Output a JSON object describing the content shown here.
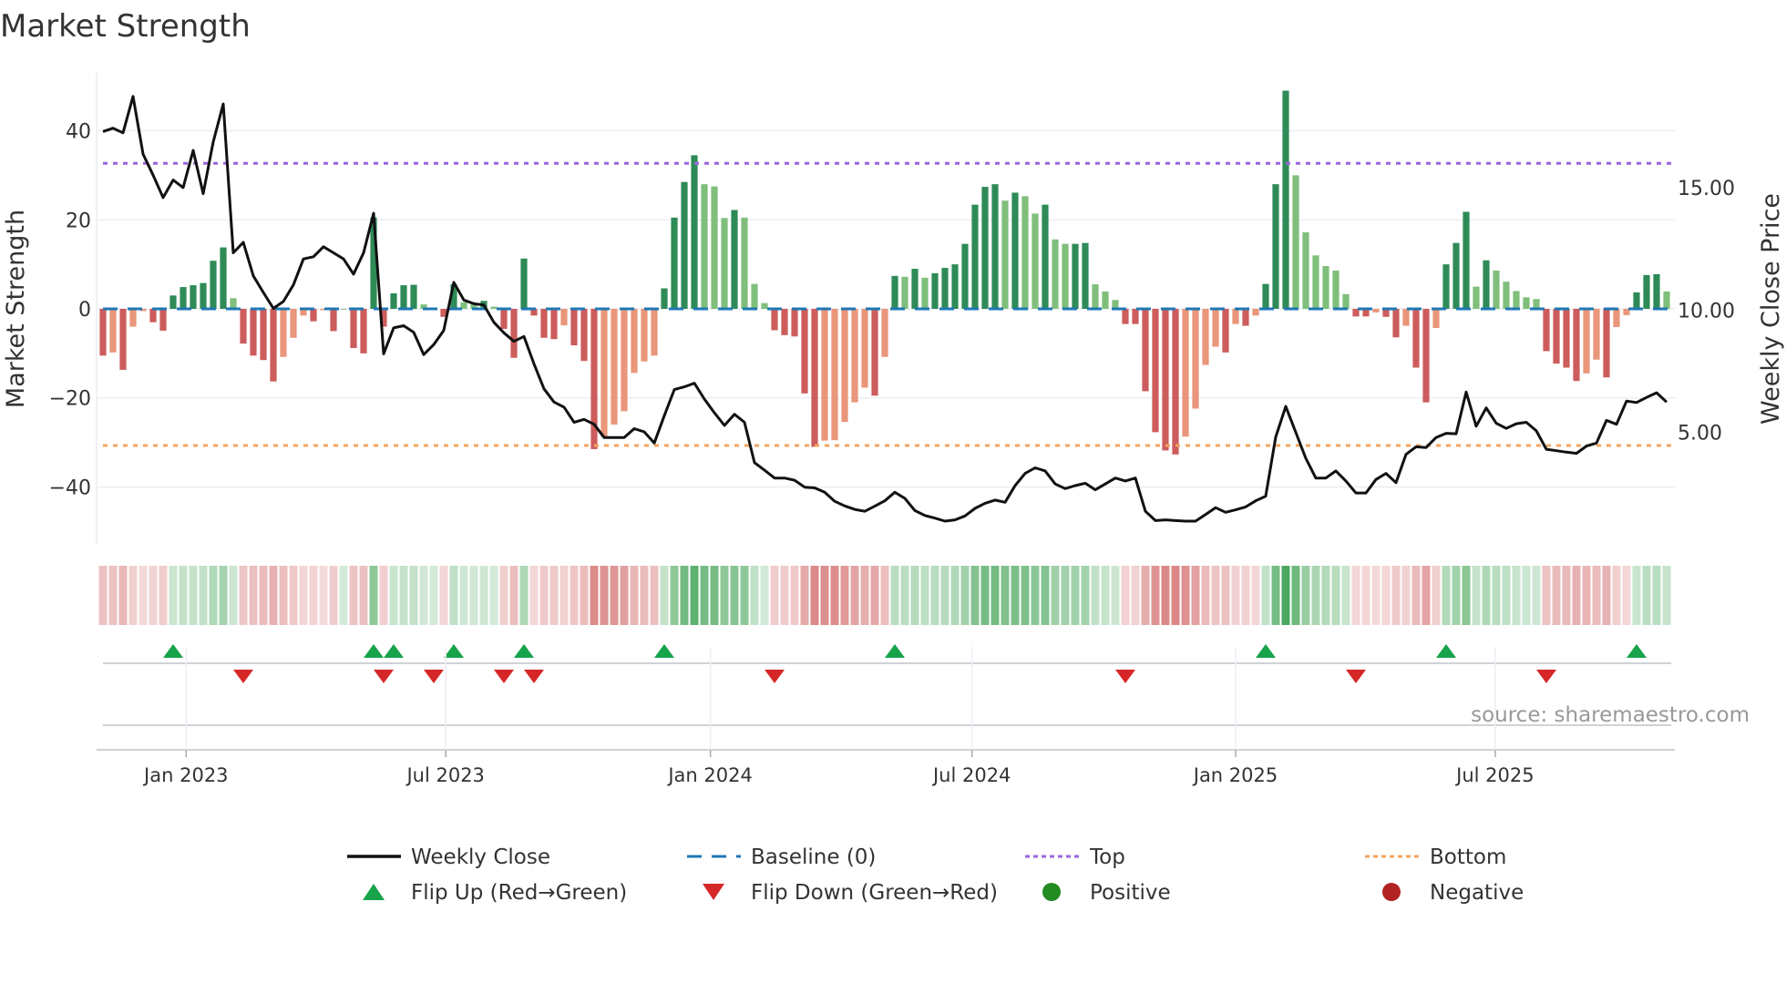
{
  "chart_data": {
    "type": "bar",
    "title": "Market Strength",
    "ylabel": "Market Strength",
    "y2label": "Weekly Close Price",
    "ylim": [
      -53,
      53
    ],
    "y2lim": [
      0.4,
      19.7
    ],
    "yticks": [
      {
        "v": 40,
        "label": "40"
      },
      {
        "v": 20,
        "label": "20"
      },
      {
        "v": 0,
        "label": "0"
      },
      {
        "v": -20,
        "label": "−20"
      },
      {
        "v": -40,
        "label": "−40"
      }
    ],
    "y2ticks": [
      {
        "v": 15,
        "label": "15.00"
      },
      {
        "v": 10,
        "label": "10.00"
      },
      {
        "v": 5,
        "label": "5.00"
      }
    ],
    "xticks": [
      {
        "week": 8.3,
        "label": "Jan 2023"
      },
      {
        "week": 34.2,
        "label": "Jul 2023"
      },
      {
        "week": 60.6,
        "label": "Jan 2024"
      },
      {
        "week": 86.7,
        "label": "Jul 2024"
      },
      {
        "week": 113.0,
        "label": "Jan 2025"
      },
      {
        "week": 138.9,
        "label": "Jul 2025"
      }
    ],
    "top_level": 32.7,
    "bottom_level": -30.7,
    "baseline": 0,
    "grid": true,
    "strength": [
      -10.5,
      -9.8,
      -13.7,
      -4,
      -0.5,
      -3,
      -4.9,
      3,
      4.9,
      5.3,
      5.8,
      10.8,
      13.8,
      2.4,
      -7.8,
      -10.5,
      -11.5,
      -16.3,
      -10.8,
      -6.5,
      -1.5,
      -2.8,
      -0.3,
      -5,
      0,
      -8.8,
      -10,
      20.5,
      -4,
      3.5,
      5.3,
      5.4,
      1,
      0,
      -1.8,
      5.5,
      1.5,
      1,
      1.8,
      0.5,
      -4.5,
      -11,
      11.3,
      -1.5,
      -6.5,
      -6.8,
      -3.7,
      -8.2,
      -11.7,
      -31.5,
      -28.7,
      -26,
      -23,
      -14.4,
      -11.8,
      -10.5,
      4.6,
      20.5,
      28.5,
      34.5,
      28,
      27.5,
      20.4,
      22.2,
      20.5,
      5.6,
      1.3,
      -4.8,
      -5.9,
      -6.2,
      -19,
      -31,
      -29.6,
      -29.5,
      -25.4,
      -21,
      -17.7,
      -19.5,
      -10.8,
      7.4,
      7.2,
      9,
      7,
      8,
      9.2,
      10,
      14.6,
      23.4,
      27.4,
      28,
      24.3,
      26.1,
      25.3,
      21.4,
      23.4,
      15.6,
      14.6,
      14.6,
      14.8,
      5.5,
      3.9,
      2,
      -3.4,
      -3.4,
      -18.5,
      -27.7,
      -31.8,
      -32.7,
      -28.7,
      -22.4,
      -12.6,
      -8.5,
      -9.8,
      -3.4,
      -3.8,
      -1.5,
      5.6,
      28,
      49,
      30,
      17.2,
      12,
      9.6,
      8.6,
      3.3,
      -1.7,
      -1.7,
      -0.8,
      -1.8,
      -6.4,
      -3.8,
      -13.2,
      -21,
      -4.3,
      10,
      14.8,
      21.8,
      5,
      10.9,
      8.6,
      6.1,
      4,
      2.6,
      2.2,
      -9.5,
      -12.3,
      -13.2,
      -16.2,
      -14.5,
      -11.4,
      -15.4,
      -4.1,
      -1.4,
      3.7,
      7.6,
      7.8,
      3.9
    ],
    "weekly_close": [
      17.3,
      17.44,
      17.25,
      18.74,
      16.38,
      15.52,
      14.6,
      15.32,
      15.01,
      16.53,
      14.76,
      16.88,
      18.43,
      12.34,
      12.77,
      11.4,
      10.72,
      10.07,
      10.35,
      11.03,
      12.09,
      12.18,
      12.59,
      12.34,
      12.09,
      11.47,
      12.34,
      13.96,
      8.21,
      9.27,
      9.36,
      9.09,
      8.18,
      8.59,
      9.17,
      11.13,
      10.41,
      10.26,
      10.21,
      9.5,
      9.07,
      8.72,
      8.92,
      7.8,
      6.78,
      6.24,
      6.03,
      5.41,
      5.53,
      5.33,
      4.79,
      4.79,
      4.79,
      5.15,
      5.02,
      4.56,
      5.68,
      6.75,
      6.86,
      7.01,
      6.36,
      5.8,
      5.28,
      5.74,
      5.41,
      3.76,
      3.45,
      3.13,
      3.13,
      3.04,
      2.76,
      2.73,
      2.55,
      2.18,
      1.99,
      1.85,
      1.77,
      1.98,
      2.2,
      2.55,
      2.3,
      1.8,
      1.6,
      1.49,
      1.37,
      1.42,
      1.58,
      1.89,
      2.1,
      2.23,
      2.14,
      2.82,
      3.32,
      3.55,
      3.42,
      2.89,
      2.7,
      2.82,
      2.92,
      2.65,
      2.89,
      3.13,
      3.01,
      3.13,
      1.77,
      1.39,
      1.42,
      1.39,
      1.37,
      1.37,
      1.64,
      1.92,
      1.73,
      1.83,
      1.95,
      2.2,
      2.39,
      4.81,
      6.06,
      5.0,
      3.94,
      3.13,
      3.13,
      3.42,
      3.01,
      2.52,
      2.52,
      3.07,
      3.32,
      2.94,
      4.1,
      4.41,
      4.38,
      4.79,
      4.96,
      4.94,
      6.65,
      5.25,
      6.0,
      5.37,
      5.16,
      5.35,
      5.41,
      5.06,
      4.31,
      4.25,
      4.19,
      4.14,
      4.44,
      4.56,
      5.49,
      5.33,
      6.28,
      6.22,
      6.43,
      6.62,
      6.24
    ],
    "flip_up_weeks": [
      7,
      27,
      29,
      35,
      42,
      56,
      79,
      116,
      134,
      153
    ],
    "flip_down_weeks": [
      14,
      28,
      33,
      40,
      43,
      67,
      102,
      125,
      144
    ],
    "legend": {
      "placement": "bottom",
      "items": [
        {
          "key": "weekly_close",
          "label": "Weekly Close"
        },
        {
          "key": "baseline",
          "label": "Baseline (0)"
        },
        {
          "key": "top",
          "label": "Top"
        },
        {
          "key": "bottom",
          "label": "Bottom"
        },
        {
          "key": "flip_up",
          "label": "Flip Up (Red→Green)"
        },
        {
          "key": "flip_down",
          "label": "Flip Down (Green→Red)"
        },
        {
          "key": "positive",
          "label": "Positive"
        },
        {
          "key": "negative",
          "label": "Negative"
        }
      ]
    },
    "source": "source: sharemaestro.com"
  },
  "colors": {
    "pos_strong": "#2e8b57",
    "pos_weak": "#7fbf7b",
    "neg_strong": "#cd5c5c",
    "neg_weak": "#e9967a",
    "line": "#111111",
    "baseline": "#1f77b4",
    "top": "#9966dd",
    "bottom": "#f4a460",
    "flip_up": "#16a34a",
    "flip_down": "#d62728",
    "positive": "#228b22",
    "negative": "#b22222",
    "grid": "#eceef3"
  }
}
